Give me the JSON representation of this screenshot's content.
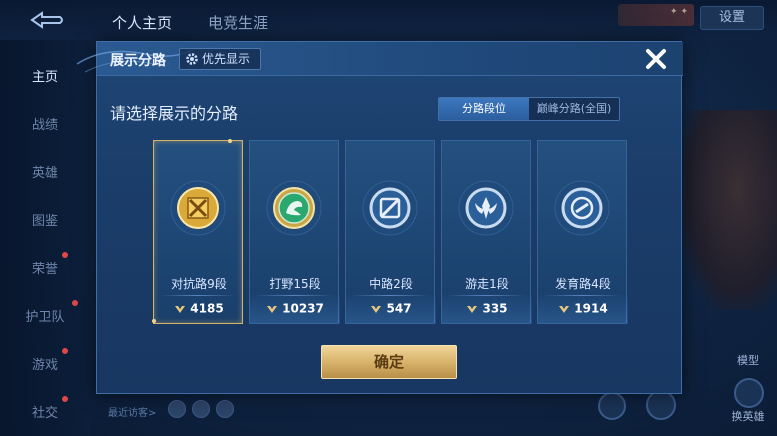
{
  "top_tabs": [
    "个人主页",
    "电竞生涯"
  ],
  "settings_label": "设置",
  "side_nav": [
    {
      "label": "主页",
      "active": true,
      "dot": false
    },
    {
      "label": "战绩",
      "active": false,
      "dot": false
    },
    {
      "label": "英雄",
      "active": false,
      "dot": false
    },
    {
      "label": "图鉴",
      "active": false,
      "dot": false
    },
    {
      "label": "荣誉",
      "active": false,
      "dot": true
    },
    {
      "label": "护卫队",
      "active": false,
      "dot": true
    },
    {
      "label": "游戏",
      "active": false,
      "dot": true
    },
    {
      "label": "社交",
      "active": false,
      "dot": true
    }
  ],
  "recent_visitors_label": "最近访客>",
  "right_labels": {
    "model": "模型",
    "swap_hero": "换英雄"
  },
  "modal": {
    "title": "展示分路",
    "priority_label": "优先显示",
    "subtitle": "请选择展示的分路",
    "toggle": [
      {
        "label": "分路段位",
        "active": true
      },
      {
        "label": "巅峰分路(全国)",
        "active": false
      }
    ],
    "cards": [
      {
        "name": "对抗路9段",
        "score": "4185",
        "selected": true,
        "icon": "crossed-swords-badge-icon",
        "badge_color": "#d9a93a",
        "inner_color": "#f4cf63"
      },
      {
        "name": "打野15段",
        "score": "10237",
        "selected": false,
        "icon": "dragon-badge-icon",
        "badge_color": "#c9a748",
        "inner_color": "#2aa86f"
      },
      {
        "name": "中路2段",
        "score": "547",
        "selected": false,
        "icon": "mid-lane-badge-icon",
        "badge_color": "#9fb6cf",
        "inner_color": "#dfe9f5"
      },
      {
        "name": "游走1段",
        "score": "335",
        "selected": false,
        "icon": "roam-wings-badge-icon",
        "badge_color": "#9fb6cf",
        "inner_color": "#dfe9f5"
      },
      {
        "name": "发育路4段",
        "score": "1914",
        "selected": false,
        "icon": "farm-lane-badge-icon",
        "badge_color": "#9fb6cf",
        "inner_color": "#dfe9f5"
      }
    ],
    "confirm_label": "确定"
  }
}
